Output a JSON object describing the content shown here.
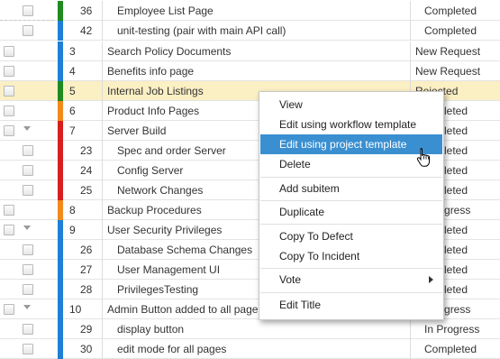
{
  "colors": {
    "green": "#1f8a1f",
    "blue": "#1e7fd6",
    "orange": "#f08a1c",
    "red": "#d71f1f",
    "selected_row": "#fbefc4",
    "menu_hover": "#3a8fd0"
  },
  "rows": [
    {
      "id": "36",
      "title": "Employee List Page",
      "status": "Completed"
    },
    {
      "id": "42",
      "title": "unit-testing (pair with main API call)",
      "status": "Completed"
    },
    {
      "id": "3",
      "title": "Search Policy Documents",
      "status": "New Request"
    },
    {
      "id": "4",
      "title": "Benefits info page",
      "status": "New Request"
    },
    {
      "id": "5",
      "title": "Internal Job Listings",
      "status": "Rejected"
    },
    {
      "id": "6",
      "title": "Product Info Pages",
      "status": "Completed"
    },
    {
      "id": "7",
      "title": "Server Build",
      "status": "Completed"
    },
    {
      "id": "23",
      "title": "Spec and order Server",
      "status": "Completed"
    },
    {
      "id": "24",
      "title": "Config Server",
      "status": "Completed"
    },
    {
      "id": "25",
      "title": "Network Changes",
      "status": "Completed"
    },
    {
      "id": "8",
      "title": "Backup Procedures",
      "status": "In Progress"
    },
    {
      "id": "9",
      "title": "User Security Privileges",
      "status": "Completed"
    },
    {
      "id": "26",
      "title": "Database Schema Changes",
      "status": "Completed"
    },
    {
      "id": "27",
      "title": "User Management UI",
      "status": "Completed"
    },
    {
      "id": "28",
      "title": "PrivilegesTesting",
      "status": "Completed"
    },
    {
      "id": "10",
      "title": "Admin Button added to all pages",
      "status": "In Progress"
    },
    {
      "id": "29",
      "title": "display button",
      "status": "In Progress"
    },
    {
      "id": "30",
      "title": "edit mode for all pages",
      "status": "Completed"
    }
  ],
  "context_menu": {
    "items": [
      "View",
      "Edit using workflow template",
      "Edit using project template",
      "Delete",
      "Add subitem",
      "Duplicate",
      "Copy To Defect",
      "Copy To Incident",
      "Vote",
      "Edit Title"
    ],
    "hovered": "Edit using project template"
  }
}
